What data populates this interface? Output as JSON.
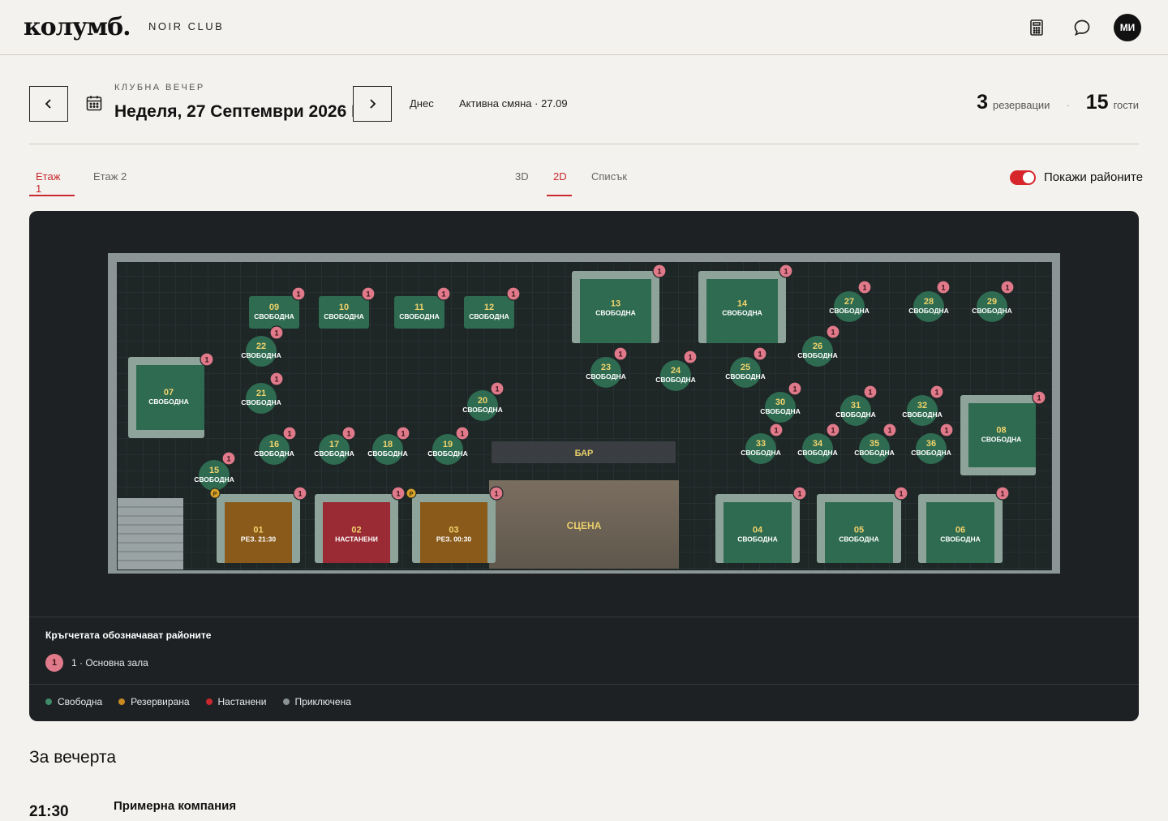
{
  "header": {
    "logo": "колумб.",
    "club_name": "NOIR CLUB",
    "icons": [
      "calculator-icon",
      "chat-icon"
    ],
    "avatar_initials": "МИ"
  },
  "datebar": {
    "kicker": "КЛУБНА ВЕЧЕР",
    "date": "Неделя, 27 Септември 2026 Г.",
    "today_label": "Днес",
    "shift_label": "Активна смяна · 27.09",
    "reservations_count": "3",
    "reservations_label": "резервации",
    "guests_count": "15",
    "guests_label": "гости"
  },
  "floor_tabs": [
    {
      "label": "Етаж 1",
      "active": true
    },
    {
      "label": "Етаж 2",
      "active": false
    }
  ],
  "view_tabs": [
    {
      "label": "3D",
      "active": false
    },
    {
      "label": "2D",
      "active": true
    },
    {
      "label": "Списък",
      "active": false
    }
  ],
  "show_zones": {
    "label": "Покажи районите",
    "on": true
  },
  "colors": {
    "free": "#2e6b51",
    "reserved": "#8a5a1a",
    "seated": "#9a2a33",
    "finished": "#7c8484",
    "zone_badge": "#e07a8a",
    "accent": "#c8282e"
  },
  "plan": {
    "bar_label": "БАР",
    "stage_label": "СЦЕНА",
    "zone_badge": "1",
    "parking_mark": "P",
    "tables": [
      {
        "id": "01",
        "status": "reserved",
        "text": "РЕЗ. 21:30"
      },
      {
        "id": "02",
        "status": "seated",
        "text": "НАСТАНЕНИ"
      },
      {
        "id": "03",
        "status": "reserved",
        "text": "РЕЗ. 00:30"
      },
      {
        "id": "04",
        "status": "free",
        "text": "СВОБОДНА"
      },
      {
        "id": "05",
        "status": "free",
        "text": "СВОБОДНА"
      },
      {
        "id": "06",
        "status": "free",
        "text": "СВОБОДНА"
      },
      {
        "id": "07",
        "status": "free",
        "text": "СВОБОДНА"
      },
      {
        "id": "08",
        "status": "free",
        "text": "СВОБОДНА"
      },
      {
        "id": "09",
        "status": "free",
        "text": "СВОБОДНА"
      },
      {
        "id": "10",
        "status": "free",
        "text": "СВОБОДНА"
      },
      {
        "id": "11",
        "status": "free",
        "text": "СВОБОДНА"
      },
      {
        "id": "12",
        "status": "free",
        "text": "СВОБОДНА"
      },
      {
        "id": "13",
        "status": "free",
        "text": "СВОБОДНА"
      },
      {
        "id": "14",
        "status": "free",
        "text": "СВОБОДНА"
      },
      {
        "id": "15",
        "status": "free",
        "text": "СВОБОДНА"
      },
      {
        "id": "16",
        "status": "free",
        "text": "СВОБОДНА"
      },
      {
        "id": "17",
        "status": "free",
        "text": "СВОБОДНА"
      },
      {
        "id": "18",
        "status": "free",
        "text": "СВОБОДНА"
      },
      {
        "id": "19",
        "status": "free",
        "text": "СВОБОДНА"
      },
      {
        "id": "20",
        "status": "free",
        "text": "СВОБОДНА"
      },
      {
        "id": "21",
        "status": "free",
        "text": "СВОБОДНА"
      },
      {
        "id": "22",
        "status": "free",
        "text": "СВОБОДНА"
      },
      {
        "id": "23",
        "status": "free",
        "text": "СВОБОДНА"
      },
      {
        "id": "24",
        "status": "free",
        "text": "СВОБОДНА"
      },
      {
        "id": "25",
        "status": "free",
        "text": "СВОБОДНА"
      },
      {
        "id": "26",
        "status": "free",
        "text": "СВОБОДНА"
      },
      {
        "id": "27",
        "status": "free",
        "text": "СВОБОДНА"
      },
      {
        "id": "28",
        "status": "free",
        "text": "СВОБОДНА"
      },
      {
        "id": "29",
        "status": "free",
        "text": "СВОБОДНА"
      },
      {
        "id": "30",
        "status": "free",
        "text": "СВОБОДНА"
      },
      {
        "id": "31",
        "status": "free",
        "text": "СВОБОДНА"
      },
      {
        "id": "32",
        "status": "free",
        "text": "СВОБОДНА"
      },
      {
        "id": "33",
        "status": "free",
        "text": "СВОБОДНА"
      },
      {
        "id": "34",
        "status": "free",
        "text": "СВОБОДНА"
      },
      {
        "id": "35",
        "status": "free",
        "text": "СВОБОДНА"
      },
      {
        "id": "36",
        "status": "free",
        "text": "СВОБОДНА"
      }
    ]
  },
  "legend": {
    "title": "Кръгчетата обозначават районите",
    "zone_number": "1",
    "zone_label": "1 · Основна зала",
    "statuses": [
      {
        "label": "Свободна",
        "color": "#3f8a68"
      },
      {
        "label": "Резервирана",
        "color": "#c98a22"
      },
      {
        "label": "Настанени",
        "color": "#c8282e"
      },
      {
        "label": "Приключена",
        "color": "#8a9292"
      }
    ]
  },
  "evening": {
    "title": "За вечерта",
    "first_time": "21:30",
    "first_name": "Примерна компания"
  }
}
